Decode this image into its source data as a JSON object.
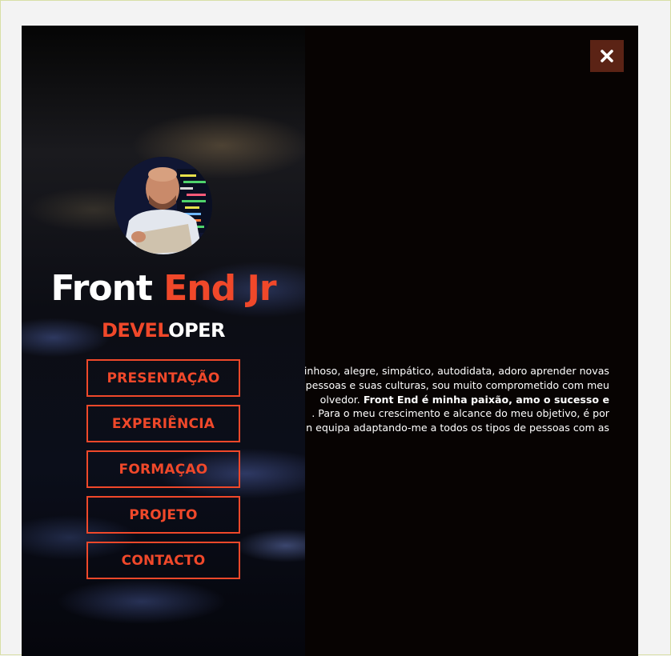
{
  "profile": {
    "title_part1": "Front ",
    "title_part2": "End Jr",
    "subtitle_part1": "DEVEL",
    "subtitle_part2": "OPER"
  },
  "nav": {
    "items": [
      {
        "label": "PRESENTAÇÃO"
      },
      {
        "label": "EXPERIÊNCIA"
      },
      {
        "label": "FORMAÇAO"
      },
      {
        "label": "PROJETO"
      },
      {
        "label": "CONTACTO"
      }
    ]
  },
  "close": {
    "icon": "close-icon"
  },
  "about": {
    "line1": "inhoso, alegre, simpático, autodidata, adoro aprender novas",
    "line2": "pessoas e suas culturas, sou muito comprometido com meu",
    "line3_a": "olvedor. ",
    "line3_b": "Front End é minha paixão, amo o sucesso e",
    "line4": ". Para o meu crescimento e alcance do meu objetivo, é por",
    "line5": "n equipa adaptando-me a todos os tipos de pessoas com as"
  },
  "colors": {
    "accent": "#f0482a",
    "close_bg": "#5b2315",
    "panel_bg": "#070302",
    "page_bg": "#f3f3f3"
  }
}
